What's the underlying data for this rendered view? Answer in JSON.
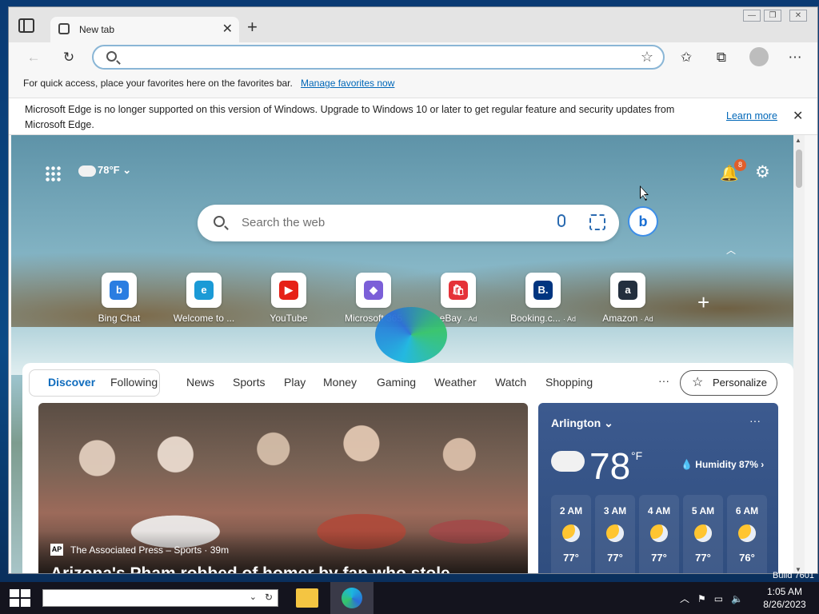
{
  "browser": {
    "tab_title": "New tab",
    "address_placeholder": "",
    "favorites_bar_text": "For quick access, place your favorites here on the favorites bar.",
    "favorites_bar_link": "Manage favorites now"
  },
  "notice": {
    "text": "Microsoft Edge is no longer supported on this version of Windows. Upgrade to Windows 10 or later to get regular feature and security updates from Microsoft Edge.",
    "link": "Learn more"
  },
  "header": {
    "weather_temp": "78°F",
    "notification_count": "8"
  },
  "search": {
    "placeholder": "Search the web"
  },
  "tiles": [
    {
      "label": "Bing Chat",
      "ad": "",
      "glyph": "b",
      "color": "#2a7de1"
    },
    {
      "label": "Welcome to ...",
      "ad": "",
      "glyph": "e",
      "color": "#1b9ad6"
    },
    {
      "label": "YouTube",
      "ad": "",
      "glyph": "▶",
      "color": "#e62117"
    },
    {
      "label": "Microsoft 365",
      "ad": "",
      "glyph": "◆",
      "color": "#7b5fd8"
    },
    {
      "label": "eBay",
      "ad": "· Ad",
      "glyph": "🛍",
      "color": "#e53238"
    },
    {
      "label": "Booking.c...",
      "ad": "· Ad",
      "glyph": "B.",
      "color": "#003580"
    },
    {
      "label": "Amazon",
      "ad": "· Ad",
      "glyph": "a",
      "color": "#232f3e"
    }
  ],
  "feed": {
    "tabs": [
      "Discover",
      "Following",
      "News",
      "Sports",
      "Play",
      "Money",
      "Gaming",
      "Weather",
      "Watch",
      "Shopping"
    ],
    "more": "···",
    "personalize": "Personalize"
  },
  "hero": {
    "source": "The Associated Press – Sports · 39m",
    "title": "Arizona's Pham robbed of homer by fan who stole"
  },
  "weather": {
    "city": "Arlington",
    "temp": "78",
    "unit": "°F",
    "humidity": "Humidity 87%",
    "hourly": [
      {
        "time": "2 AM",
        "temp": "77°"
      },
      {
        "time": "3 AM",
        "temp": "77°"
      },
      {
        "time": "4 AM",
        "temp": "77°"
      },
      {
        "time": "5 AM",
        "temp": "77°"
      },
      {
        "time": "6 AM",
        "temp": "76°"
      }
    ]
  },
  "os": {
    "build": "Build 7601",
    "time": "1:05 AM",
    "date": "8/26/2023"
  }
}
